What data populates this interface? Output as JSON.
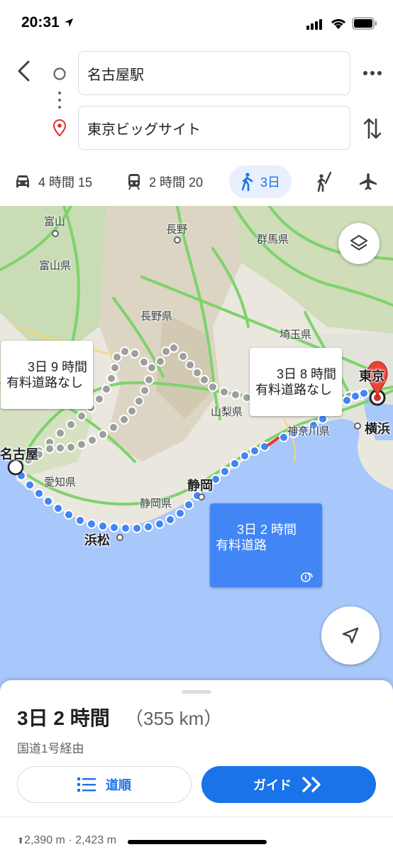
{
  "status": {
    "time": "20:31"
  },
  "route": {
    "origin": "名古屋駅",
    "destination": "東京ビッグサイト"
  },
  "modes": [
    {
      "icon": "car-icon",
      "label": "4 時間 15"
    },
    {
      "icon": "train-icon",
      "label": "2 時間 20"
    },
    {
      "icon": "walk-icon",
      "label": "3日"
    },
    {
      "icon": "rideshare-icon",
      "label": ""
    },
    {
      "icon": "flight-icon",
      "label": ""
    }
  ],
  "map": {
    "places": {
      "toyama": "富山",
      "toyama_pref": "富山県",
      "nagano": "長野",
      "nagano_pref": "長野県",
      "gunma_pref": "群馬県",
      "saitama_pref": "埼玉県",
      "yamanashi_pref": "山梨県",
      "kanagawa_pref": "神奈川県",
      "aichi_pref": "愛知県",
      "shizuoka_pref": "静岡県",
      "nagoya": "名古屋",
      "shizuoka": "静岡",
      "hamamatsu": "浜松",
      "yokohama": "横浜",
      "tokyo": "東京"
    },
    "callouts": {
      "alt1": "3日 9 時間\n有料道路なし",
      "alt2": "3日 8 時間\n有料道路なし",
      "selected": "3日 2 時間\n有料道路"
    }
  },
  "summary": {
    "duration": "3日 2 時間",
    "distance": "（355 km）",
    "via": "国道1号経由",
    "steps_label": "道順",
    "guide_label": "ガイド",
    "elevation": "2,390 m · 2,423 m"
  },
  "colors": {
    "accent": "#1a73e8",
    "route": "#4285f4",
    "alt_route": "#9e9e9e",
    "destination": "#d93025"
  }
}
